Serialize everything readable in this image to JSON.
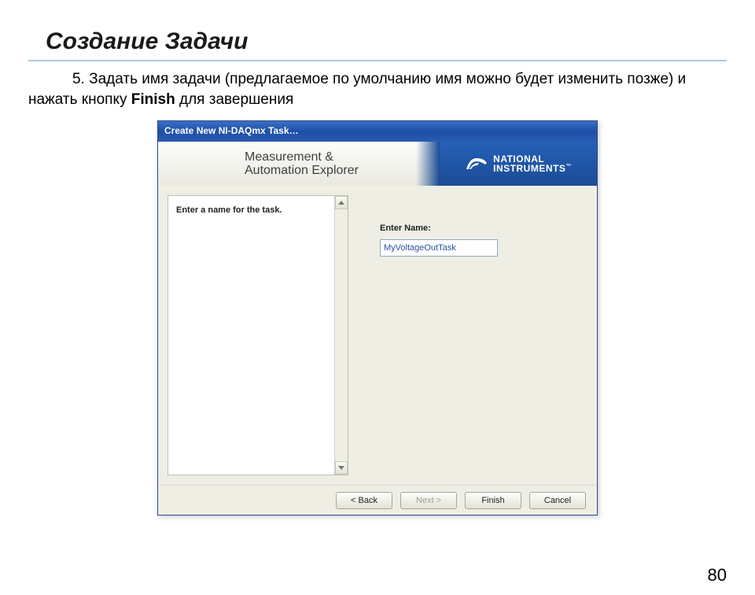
{
  "slide": {
    "title": "Создание Задачи",
    "instruction_num": "5.",
    "instruction_part1": "Задать имя задачи (предлагаемое по умолчанию имя можно будет изменить позже) и нажать кнопку ",
    "instruction_bold": "Finish",
    "instruction_part2": " для завершения",
    "page": "80"
  },
  "dialog": {
    "title": "Create New NI-DAQmx Task…",
    "banner_line1": "Measurement &",
    "banner_line2": "Automation Explorer",
    "brand_line1": "NATIONAL",
    "brand_line2": "INSTRUMENTS",
    "tm": "™",
    "info_text": "Enter a name for the task.",
    "form_label": "Enter Name:",
    "task_name": "MyVoltageOutTask",
    "buttons": {
      "back": "< Back",
      "next": "Next >",
      "finish": "Finish",
      "cancel": "Cancel"
    }
  }
}
